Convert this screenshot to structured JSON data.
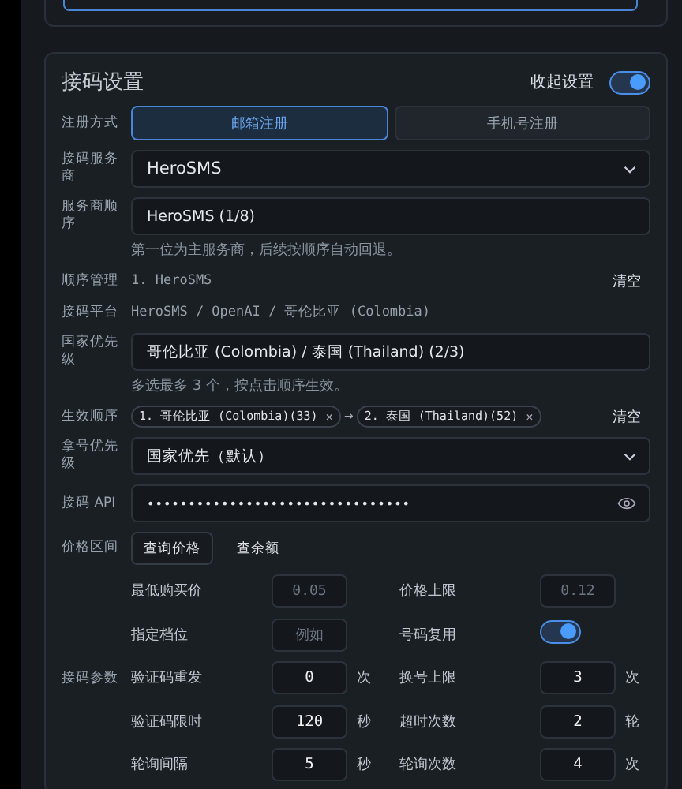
{
  "section": {
    "title": "接码设置",
    "collapse_label": "收起设置",
    "collapse_on": true
  },
  "register_mode": {
    "label": "注册方式",
    "options": [
      {
        "label": "邮箱注册",
        "selected": true
      },
      {
        "label": "手机号注册",
        "selected": false
      }
    ]
  },
  "provider": {
    "label": "接码服务商",
    "value": "HeroSMS"
  },
  "provider_order": {
    "label": "服务商顺序",
    "value": "HeroSMS (1/8)",
    "hint": "第一位为主服务商，后续按顺序自动回退。"
  },
  "order_manage": {
    "label": "顺序管理",
    "value": "1. HeroSMS",
    "action": "清空"
  },
  "platform": {
    "label": "接码平台",
    "value": "HeroSMS / OpenAI / 哥伦比亚 (Colombia)"
  },
  "country_priority": {
    "label": "国家优先级",
    "value": "哥伦比亚 (Colombia) / 泰国 (Thailand) (2/3)",
    "hint": "多选最多 3 个，按点击顺序生效。"
  },
  "effective_order": {
    "label": "生效顺序",
    "chips": [
      "1. 哥伦比亚 (Colombia)(33)",
      "2. 泰国 (Thailand)(52)"
    ],
    "separator": "→",
    "remove": "×",
    "action": "清空"
  },
  "number_priority": {
    "label": "拿号优先级",
    "value": "国家优先（默认）"
  },
  "api": {
    "label": "接码 API",
    "value": "••••••••••••••••••••••••••••••••"
  },
  "price": {
    "label": "价格区间",
    "buttons": [
      {
        "label": "查询价格",
        "kind": "outlined"
      },
      {
        "label": "查余额",
        "kind": "text"
      }
    ]
  },
  "params": {
    "label": "接码参数",
    "rows": [
      [
        {
          "label": "最低购买价",
          "kind": "input",
          "placeholder": "0.05"
        },
        {
          "label": "价格上限",
          "kind": "input",
          "placeholder": "0.12"
        }
      ],
      [
        {
          "label": "指定档位",
          "kind": "input",
          "placeholder": "例如"
        },
        {
          "label": "号码复用",
          "kind": "toggle",
          "on": true
        }
      ],
      [
        {
          "label": "验证码重发",
          "kind": "input",
          "value": "0",
          "unit": "次"
        },
        {
          "label": "换号上限",
          "kind": "input",
          "value": "3",
          "unit": "次"
        }
      ],
      [
        {
          "label": "验证码限时",
          "kind": "input",
          "value": "120",
          "unit": "秒"
        },
        {
          "label": "超时次数",
          "kind": "input",
          "value": "2",
          "unit": "轮"
        }
      ],
      [
        {
          "label": "轮询间隔",
          "kind": "input",
          "value": "5",
          "unit": "秒"
        },
        {
          "label": "轮询次数",
          "kind": "input",
          "value": "4",
          "unit": "次"
        }
      ]
    ]
  }
}
